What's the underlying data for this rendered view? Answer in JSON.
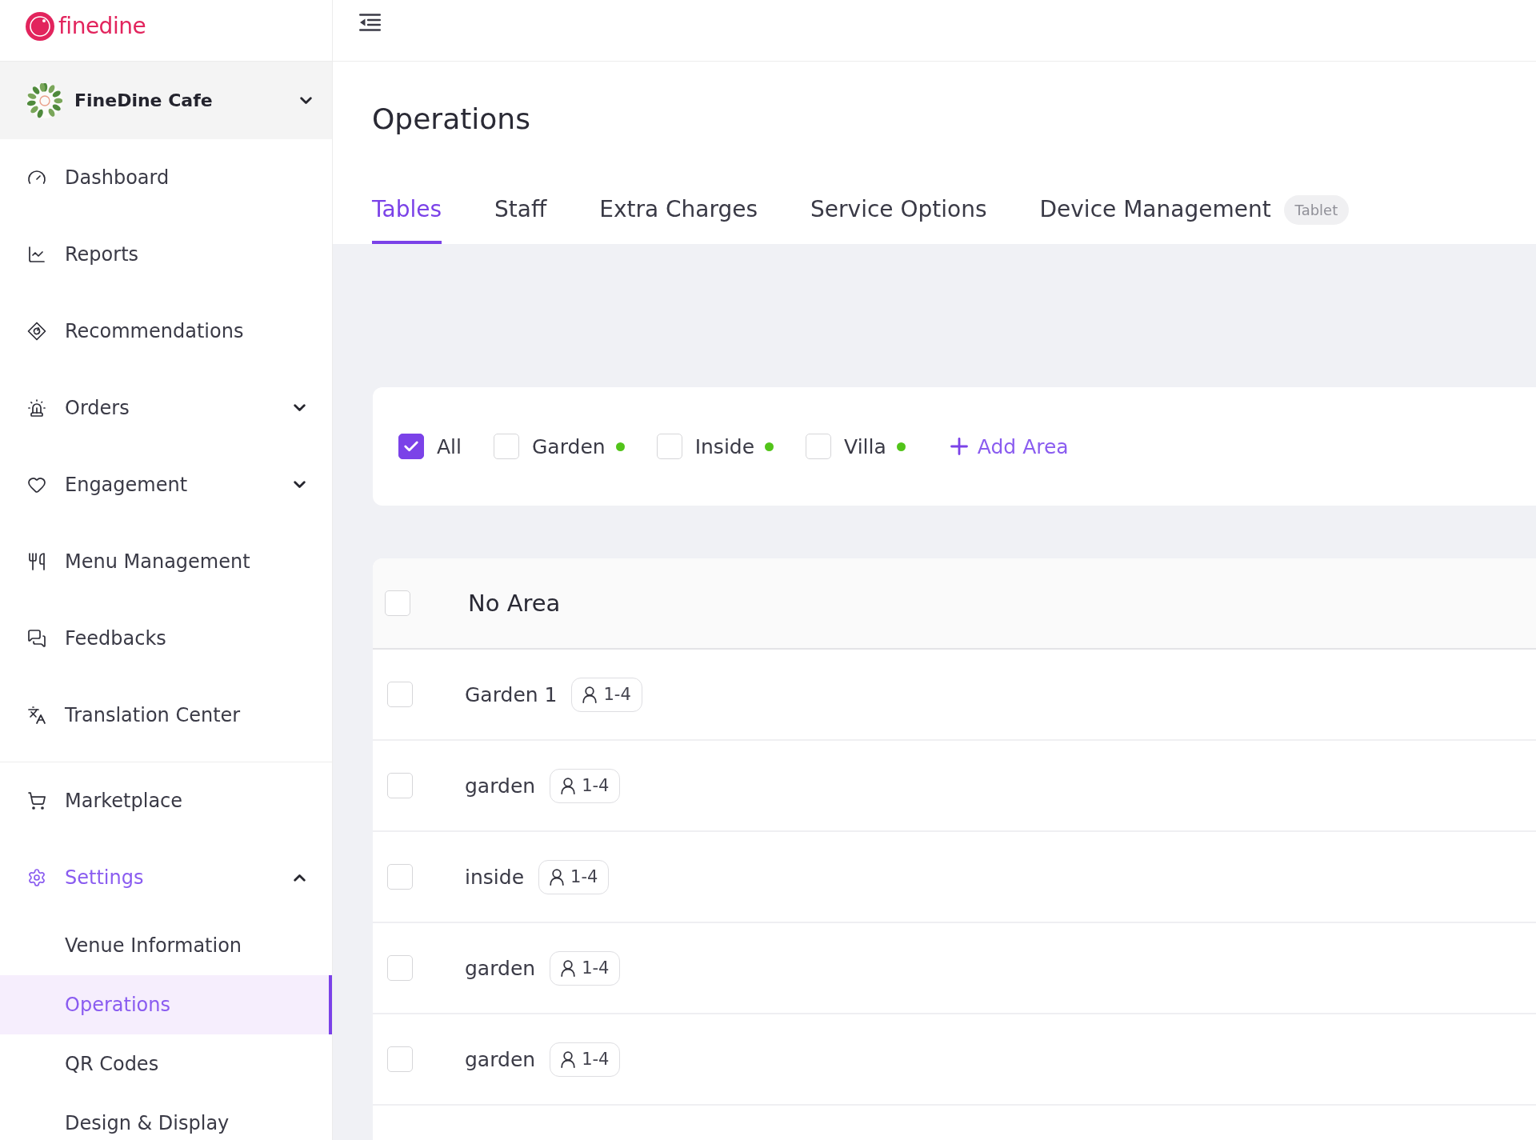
{
  "logo": {
    "text": "finedine"
  },
  "venue_switcher": {
    "name": "FineDine Cafe",
    "expanded": false
  },
  "sidebar": {
    "sections": [
      {
        "items": [
          {
            "label": "Dashboard",
            "kind": "link",
            "selected": false
          },
          {
            "label": "Reports",
            "kind": "link",
            "selected": false
          },
          {
            "label": "Recommendations",
            "kind": "link",
            "selected": false
          },
          {
            "label": "Orders",
            "kind": "group",
            "expanded": false,
            "selected": false
          },
          {
            "label": "Engagement",
            "kind": "group",
            "expanded": false,
            "selected": false
          },
          {
            "label": "Menu Management",
            "kind": "link",
            "selected": false
          },
          {
            "label": "Feedbacks",
            "kind": "link",
            "selected": false
          },
          {
            "label": "Translation Center",
            "kind": "link",
            "selected": false
          }
        ]
      },
      {
        "items": [
          {
            "label": "Marketplace",
            "kind": "link",
            "selected": false
          },
          {
            "label": "Settings",
            "kind": "group",
            "expanded": true,
            "selected": true,
            "children": [
              {
                "label": "Venue Information",
                "selected": false
              },
              {
                "label": "Operations",
                "selected": true
              },
              {
                "label": "QR Codes",
                "selected": false
              },
              {
                "label": "Design & Display",
                "selected": false
              }
            ]
          }
        ]
      }
    ]
  },
  "page": {
    "title": "Operations"
  },
  "tabs": [
    {
      "label": "Tables",
      "selected": true
    },
    {
      "label": "Staff",
      "selected": false
    },
    {
      "label": "Extra Charges",
      "selected": false
    },
    {
      "label": "Service Options",
      "selected": false
    },
    {
      "label": "Device Management",
      "selected": false,
      "badge": "Tablet"
    }
  ],
  "area_filter": {
    "options": [
      {
        "label": "All",
        "kind": "all",
        "checked": true
      },
      {
        "label": "Garden",
        "kind": "area",
        "checked": false,
        "active": true
      },
      {
        "label": "Inside",
        "kind": "area",
        "checked": false,
        "active": true
      },
      {
        "label": "Villa",
        "kind": "area",
        "checked": false,
        "active": true
      }
    ],
    "add_button": "Add Area"
  },
  "table_group": {
    "title": "No Area",
    "checked": false,
    "rows": [
      {
        "name": "Garden 1",
        "capacity": "1-4",
        "checked": false
      },
      {
        "name": "garden",
        "capacity": "1-4",
        "checked": false
      },
      {
        "name": "inside",
        "capacity": "1-4",
        "checked": false
      },
      {
        "name": "garden",
        "capacity": "1-4",
        "checked": false
      },
      {
        "name": "garden",
        "capacity": "1-4",
        "checked": false
      }
    ]
  }
}
